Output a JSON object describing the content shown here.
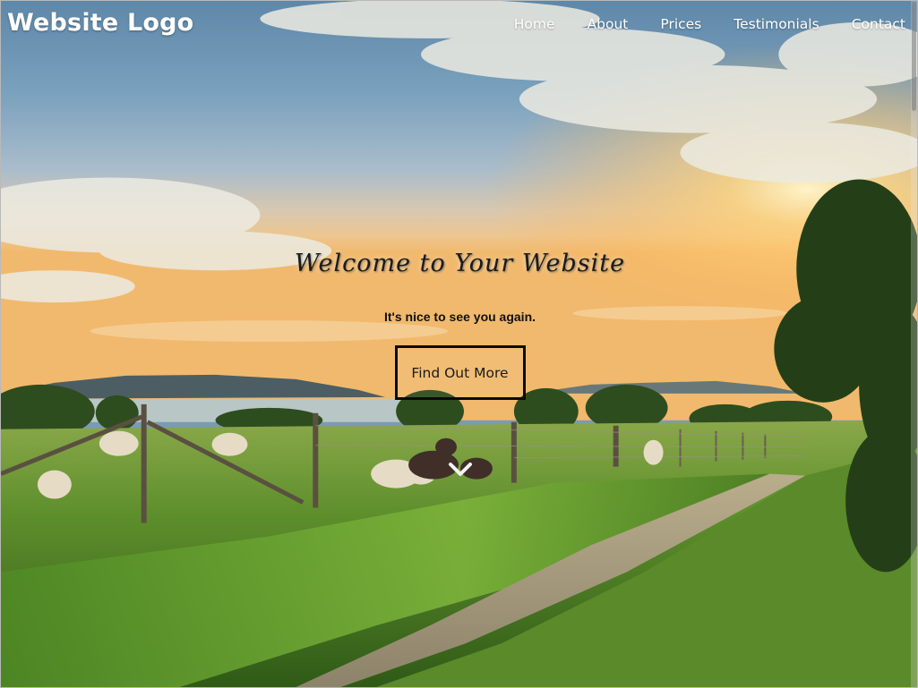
{
  "nav": {
    "logo": "Website Logo",
    "links": [
      {
        "label": "Home"
      },
      {
        "label": "About"
      },
      {
        "label": "Prices"
      },
      {
        "label": "Testimonials"
      },
      {
        "label": "Contact"
      }
    ]
  },
  "hero": {
    "title": "Welcome to Your Website",
    "subtitle": "It's nice to see you again.",
    "cta_label": "Find Out More",
    "scroll_icon": "chevron-down-icon"
  },
  "colors": {
    "nav_text": "#ffffff",
    "title_text": "#1b1b1b",
    "button_border": "#0a0a0a"
  }
}
